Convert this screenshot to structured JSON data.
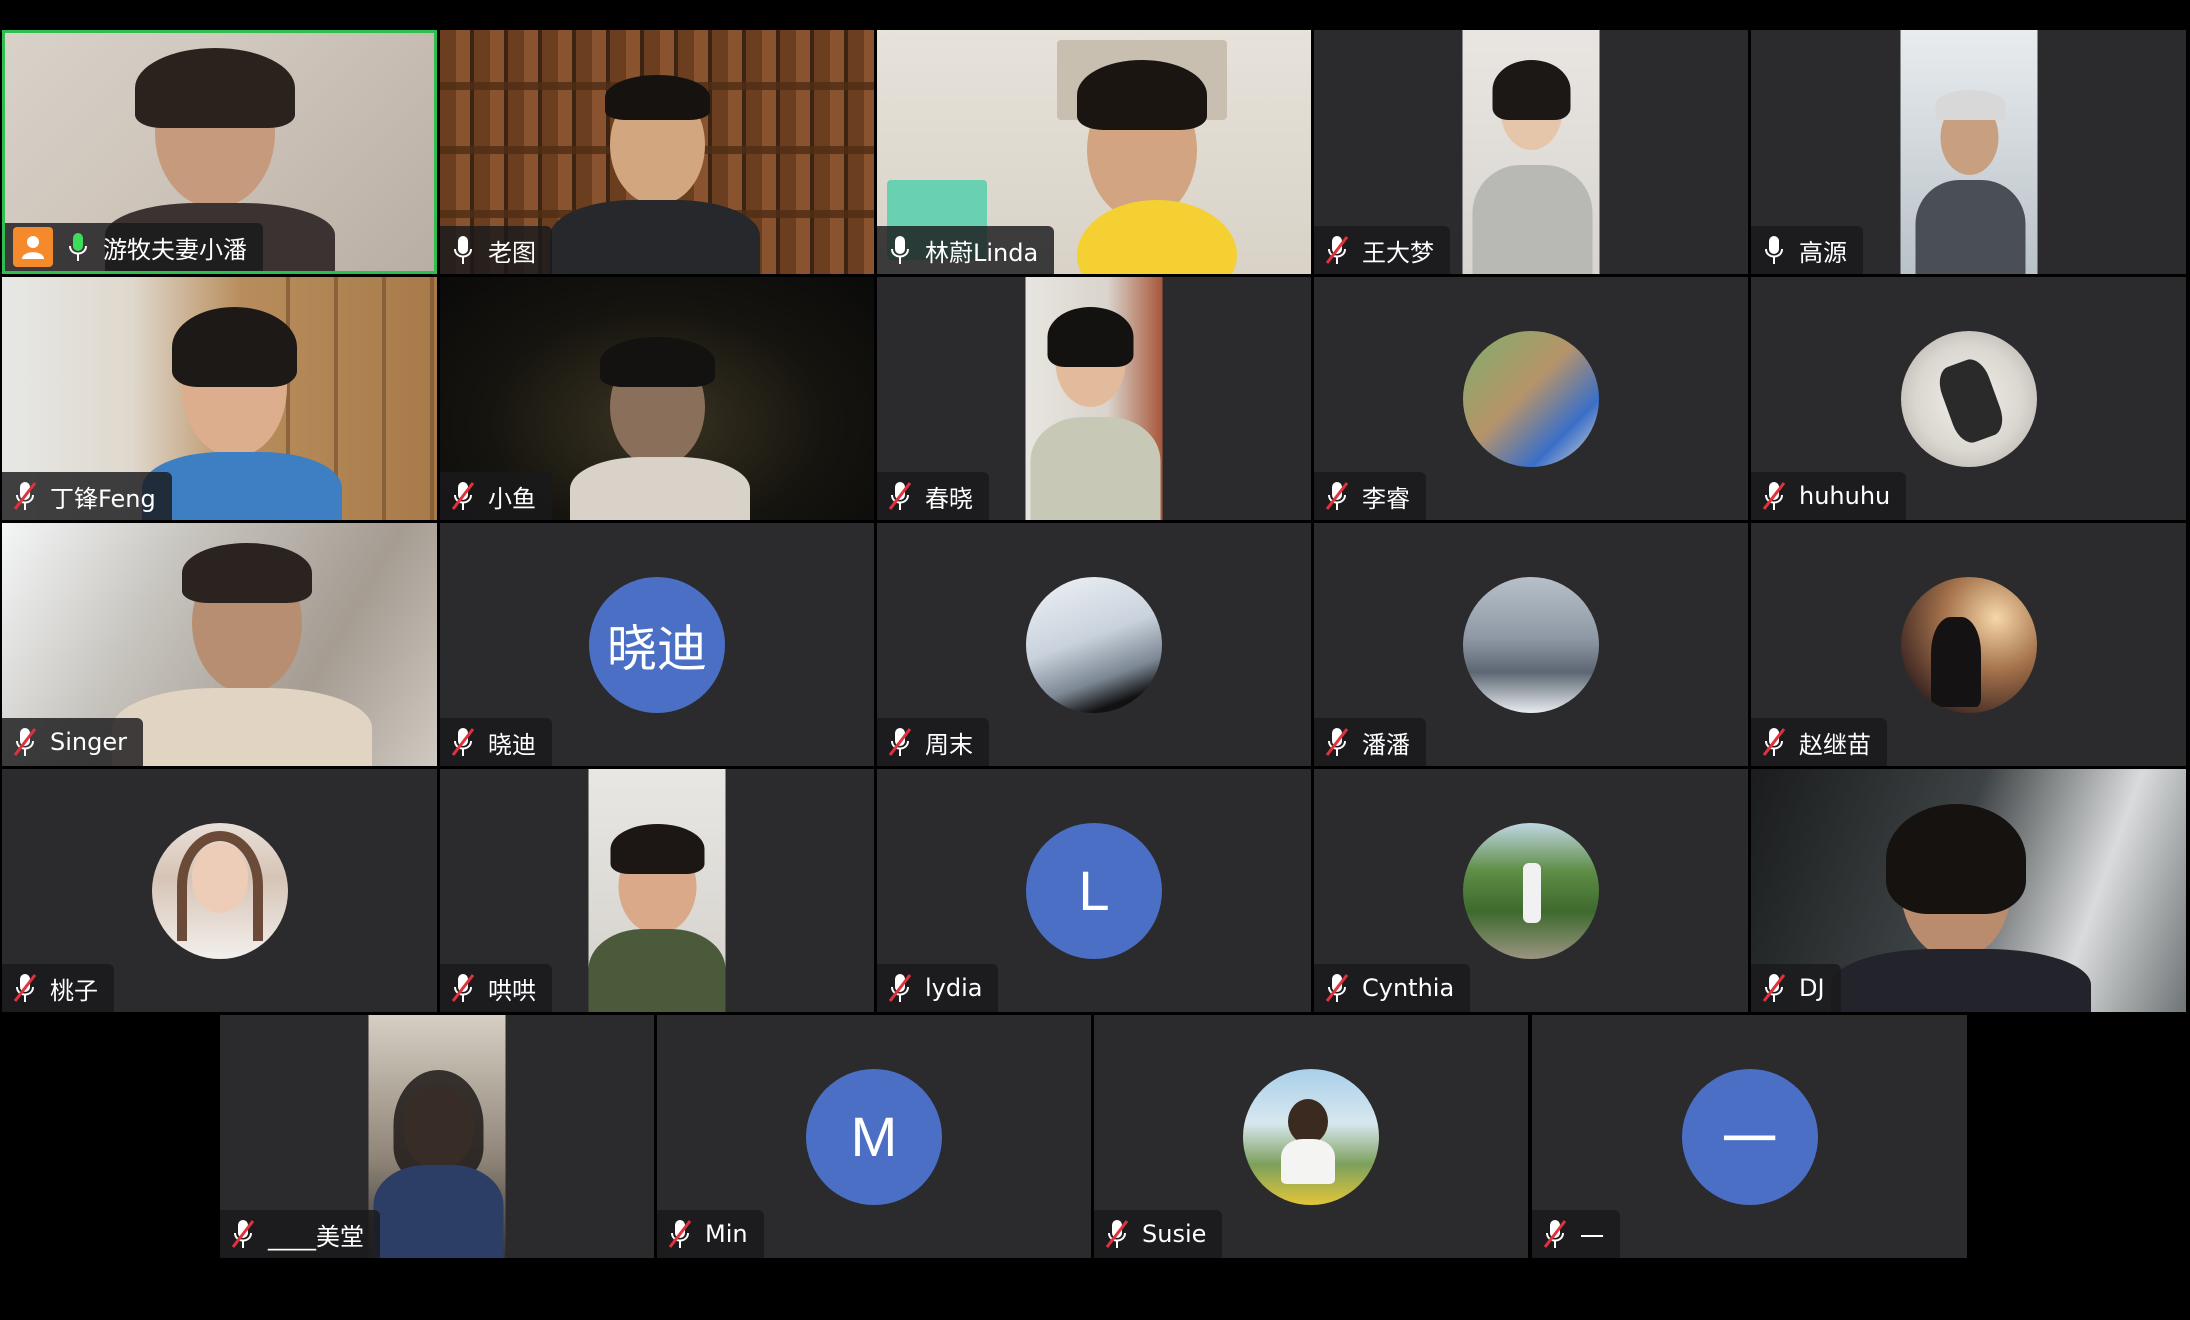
{
  "meeting": {
    "participants": [
      {
        "name": "游牧夫妻小潘",
        "mic": "on",
        "host": true,
        "active_speaker": true,
        "view": "video"
      },
      {
        "name": "老图",
        "mic": "on",
        "view": "video"
      },
      {
        "name": "林蔚Linda",
        "mic": "on",
        "view": "video"
      },
      {
        "name": "王大梦",
        "mic": "muted",
        "view": "video"
      },
      {
        "name": "高源",
        "mic": "on",
        "view": "video"
      },
      {
        "name": "丁锋Feng",
        "mic": "muted",
        "view": "video"
      },
      {
        "name": "小鱼",
        "mic": "muted",
        "view": "video"
      },
      {
        "name": "春晓",
        "mic": "muted",
        "view": "video"
      },
      {
        "name": "李睿",
        "mic": "muted",
        "view": "avatar-photo"
      },
      {
        "name": "huhuhu",
        "mic": "muted",
        "view": "avatar-photo"
      },
      {
        "name": "Singer",
        "mic": "muted",
        "view": "video"
      },
      {
        "name": "晓迪",
        "mic": "muted",
        "view": "avatar-letter",
        "avatar_text": "晓迪"
      },
      {
        "name": "周末",
        "mic": "muted",
        "view": "avatar-photo"
      },
      {
        "name": "潘潘",
        "mic": "muted",
        "view": "avatar-photo"
      },
      {
        "name": "赵继苗",
        "mic": "muted",
        "view": "avatar-photo"
      },
      {
        "name": "桃子",
        "mic": "muted",
        "view": "avatar-photo"
      },
      {
        "name": "哄哄",
        "mic": "muted",
        "view": "video"
      },
      {
        "name": "lydia",
        "mic": "muted",
        "view": "avatar-letter",
        "avatar_text": "L"
      },
      {
        "name": "Cynthia",
        "mic": "muted",
        "view": "avatar-photo"
      },
      {
        "name": "DJ",
        "mic": "muted",
        "view": "video"
      },
      {
        "name": "____美堂",
        "mic": "muted",
        "view": "video"
      },
      {
        "name": "Min",
        "mic": "muted",
        "view": "avatar-letter",
        "avatar_text": "M"
      },
      {
        "name": "Susie",
        "mic": "muted",
        "view": "avatar-photo"
      },
      {
        "name": "一",
        "mic": "muted",
        "view": "avatar-letter",
        "avatar_text": "一"
      }
    ]
  },
  "colors": {
    "tile_bg": "#2b2b2e",
    "active_border": "#2fbf51",
    "avatar_blue": "#4a6fc4",
    "host_orange": "#f58a2d",
    "mic_on_green": "#3ddc5a",
    "mic_muted_red": "#e0323c"
  },
  "icons": {
    "mic_on": "microphone-icon",
    "mic_muted": "microphone-muted-icon",
    "host": "host-person-icon"
  }
}
